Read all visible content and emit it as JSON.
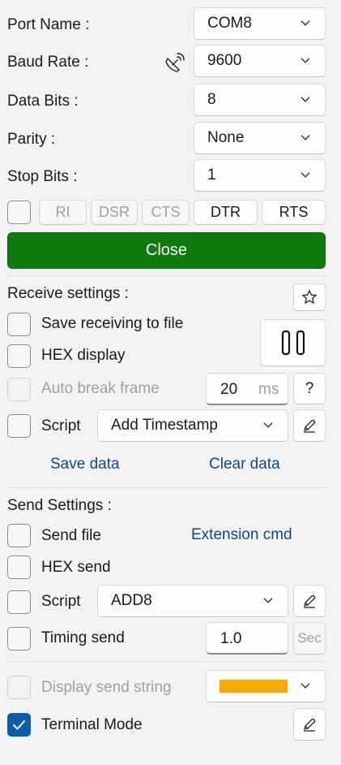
{
  "serial": {
    "port_name_label": "Port Name :",
    "port_name_value": "COM8",
    "baud_rate_label": "Baud Rate :",
    "baud_rate_value": "9600",
    "data_bits_label": "Data Bits :",
    "data_bits_value": "8",
    "parity_label": "Parity :",
    "parity_value": "None",
    "stop_bits_label": "Stop Bits :",
    "stop_bits_value": "1"
  },
  "signals": {
    "ri": "RI",
    "dsr": "DSR",
    "cts": "CTS",
    "dtr": "DTR",
    "rts": "RTS"
  },
  "close_button": "Close",
  "colors": {
    "close_bg": "#0f7a10",
    "accent": "#0b5cad",
    "color_swatch": "#f5a800"
  },
  "receive": {
    "title": "Receive settings :",
    "save_to_file": "Save receiving to file",
    "hex_display": "HEX display",
    "auto_break": "Auto break frame",
    "auto_break_value": "20",
    "auto_break_unit": "ms",
    "help": "?",
    "script_label": "Script",
    "script_value": "Add Timestamp",
    "save_data": "Save data",
    "clear_data": "Clear data"
  },
  "send": {
    "title": "Send Settings :",
    "send_file": "Send file",
    "extension_cmd": "Extension cmd",
    "hex_send": "HEX send",
    "script_label": "Script",
    "script_value": "ADD8",
    "timing_send": "Timing send",
    "timing_value": "1.0",
    "timing_unit": "Sec",
    "display_send_string": "Display send string",
    "terminal_mode": "Terminal Mode",
    "terminal_mode_checked": true
  }
}
